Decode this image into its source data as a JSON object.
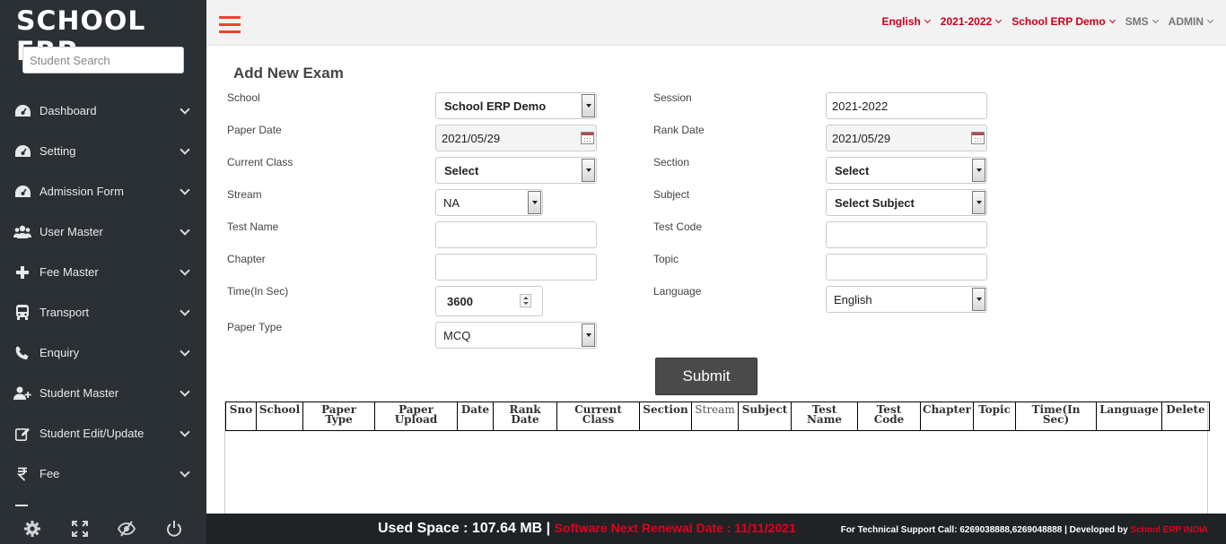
{
  "app": {
    "logo": "SCHOOL ERP"
  },
  "sidebar": {
    "search_placeholder": "Student Search",
    "items": [
      {
        "label": "Dashboard",
        "icon": "dashboard-icon"
      },
      {
        "label": "Setting",
        "icon": "dashboard-icon"
      },
      {
        "label": "Admission Form",
        "icon": "dashboard-icon"
      },
      {
        "label": "User Master",
        "icon": "users-icon"
      },
      {
        "label": "Fee Master",
        "icon": "plus-icon"
      },
      {
        "label": "Transport",
        "icon": "bus-icon"
      },
      {
        "label": "Enquiry",
        "icon": "phone-icon"
      },
      {
        "label": "Student Master",
        "icon": "user-add-icon"
      },
      {
        "label": "Student Edit/Update",
        "icon": "edit-icon"
      },
      {
        "label": "Fee",
        "icon": "rupee-icon"
      }
    ],
    "bottom_icons": [
      "gear-icon",
      "fullscreen-icon",
      "eye-slash-icon",
      "power-icon"
    ]
  },
  "topbar": {
    "items": [
      {
        "label": "English",
        "style": "red"
      },
      {
        "label": "2021-2022",
        "style": "red"
      },
      {
        "label": "School ERP Demo",
        "style": "red"
      },
      {
        "label": "SMS",
        "style": "gray"
      },
      {
        "label": "ADMIN",
        "style": "gray"
      }
    ]
  },
  "form": {
    "title": "Add New Exam",
    "school": {
      "label": "School",
      "value": "School ERP Demo"
    },
    "session": {
      "label": "Session",
      "value": "2021-2022"
    },
    "paper_date": {
      "label": "Paper Date",
      "value": "2021/05/29"
    },
    "rank_date": {
      "label": "Rank Date",
      "value": "2021/05/29"
    },
    "current_class": {
      "label": "Current Class",
      "value": "Select"
    },
    "section": {
      "label": "Section",
      "value": "Select"
    },
    "stream": {
      "label": "Stream",
      "value": "NA"
    },
    "subject": {
      "label": "Subject",
      "value": "Select Subject"
    },
    "test_name": {
      "label": "Test Name",
      "value": ""
    },
    "test_code": {
      "label": "Test Code",
      "value": ""
    },
    "chapter": {
      "label": "Chapter",
      "value": ""
    },
    "topic": {
      "label": "Topic",
      "value": ""
    },
    "time": {
      "label": "Time(In Sec)",
      "value": "3600"
    },
    "language": {
      "label": "Language",
      "value": "English"
    },
    "paper_type": {
      "label": "Paper Type",
      "value": "MCQ"
    },
    "submit_label": "Submit"
  },
  "table": {
    "headers": [
      {
        "l1": "Sno",
        "l2": ""
      },
      {
        "l1": "School",
        "l2": ""
      },
      {
        "l1": "Paper",
        "l2": "Type"
      },
      {
        "l1": "Paper",
        "l2": "Upload"
      },
      {
        "l1": "Date",
        "l2": ""
      },
      {
        "l1": "Rank",
        "l2": "Date"
      },
      {
        "l1": "Current",
        "l2": "Class"
      },
      {
        "l1": "Section",
        "l2": ""
      },
      {
        "l1": "Stream",
        "l2": ""
      },
      {
        "l1": "Subject",
        "l2": ""
      },
      {
        "l1": "Test",
        "l2": "Name"
      },
      {
        "l1": "Test",
        "l2": "Code"
      },
      {
        "l1": "Chapter",
        "l2": ""
      },
      {
        "l1": "Topic",
        "l2": ""
      },
      {
        "l1": "Time(In",
        "l2": "Sec)"
      },
      {
        "l1": "Language",
        "l2": ""
      },
      {
        "l1": "Delete",
        "l2": ""
      }
    ],
    "rows": []
  },
  "footer": {
    "used_space": "Used Space : 107.64 MB |",
    "renewal": "Software Next Renewal Date : 11/11/2021",
    "support_prefix": "For Technical Support Call: 6269038888,6269048888 | Developed by",
    "support_brand": "School ERP INDIA"
  },
  "colors": {
    "accent_red": "#c9001c",
    "sidebar_bg": "#2b3035",
    "hamburger": "#e8452c"
  }
}
